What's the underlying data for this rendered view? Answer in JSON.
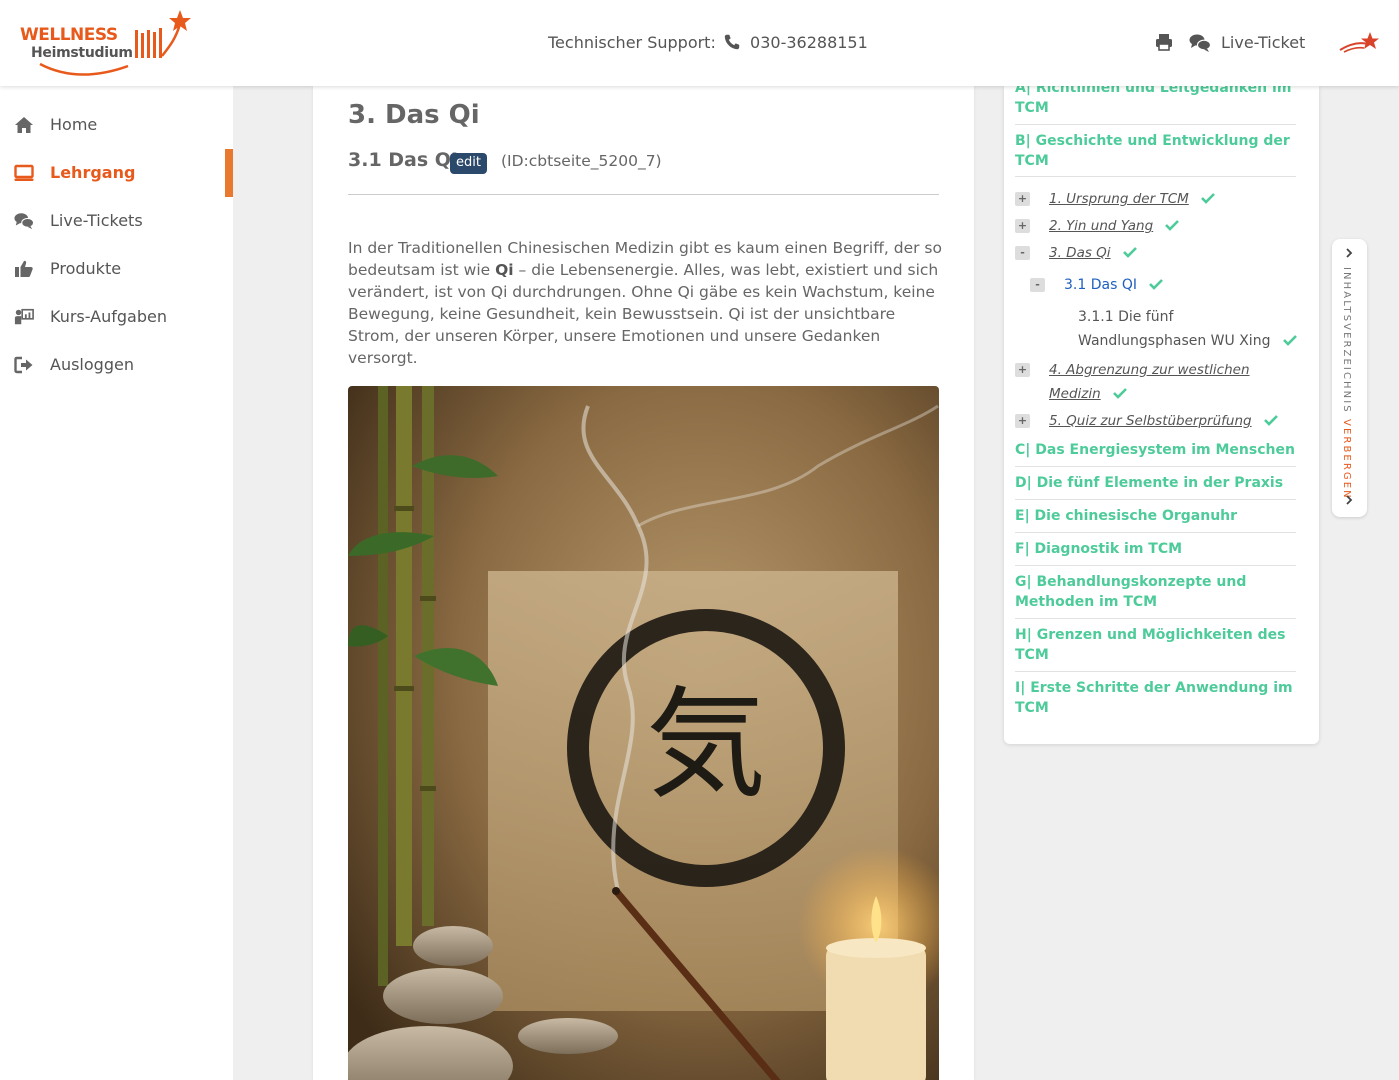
{
  "brand": {
    "logo_top": "WELLNESS",
    "logo_bottom": "Heimstudium",
    "accent": "#e8591c"
  },
  "header": {
    "support_label": "Technischer Support:",
    "support_phone": "030-36288151",
    "live_ticket_label": "Live-Ticket",
    "icons": [
      "phone-icon",
      "print-icon",
      "chat-icon",
      "star-logo-icon"
    ]
  },
  "sidebar": {
    "items": [
      {
        "label": "Home",
        "icon": "home-icon",
        "active": false
      },
      {
        "label": "Lehrgang",
        "icon": "monitor-icon",
        "active": true
      },
      {
        "label": "Live-Tickets",
        "icon": "chat-icon",
        "active": false
      },
      {
        "label": "Produkte",
        "icon": "thumbs-up-icon",
        "active": false
      },
      {
        "label": "Kurs-Aufgaben",
        "icon": "classroom-icon",
        "active": false
      },
      {
        "label": "Ausloggen",
        "icon": "logout-icon",
        "active": false
      }
    ]
  },
  "content": {
    "chapter_title": "3. Das Qi",
    "subtitle": "3.1 Das QI",
    "edit_badge": "edit",
    "page_id": "(ID:cbtseite_5200_7)",
    "para_part1": "In der Traditionellen Chinesischen Medizin gibt es kaum einen Begriff, der so bedeutsam ist wie ",
    "para_bold": "Qi",
    "para_part2": " – die Lebensenergie. Alles, was lebt, existiert und sich verändert, ist von Qi durchdrungen. Ohne Qi gäbe es kein Wachstum, keine Bewegung, keine Gesundheit, kein Bewusstsein. Qi ist der unsichtbare Strom, der unseren Körper, unsere Emotionen und unsere Gedanken versorgt.",
    "image_calligraphy": "気"
  },
  "toc": {
    "sections": [
      "A| Richtlinien und Leitgedanken im TCM",
      "B| Geschichte und Entwicklung der TCM",
      "C| Das Energiesystem im Menschen",
      "D| Die fünf Elemente in der Praxis",
      "E| Die chinesische Organuhr",
      "F| Diagnostik im TCM",
      "G| Behandlungskonzepte und Methoden im TCM",
      "H| Grenzen und Möglichkeiten des TCM",
      "I| Erste Schritte der Anwendung im TCM"
    ],
    "chapters": [
      {
        "toggle": "+",
        "label": "1. Ursprung der TCM"
      },
      {
        "toggle": "+",
        "label": "2. Yin und Yang"
      },
      {
        "toggle": "-",
        "label": "3. Das Qi"
      },
      {
        "toggle": "+",
        "label": "4. Abgrenzung zur westlichen Medizin"
      },
      {
        "toggle": "+",
        "label": "5. Quiz zur Selbstüberprüfung"
      }
    ],
    "current": {
      "toggle": "-",
      "label": "3.1 Das QI"
    },
    "subpage": "3.1.1 Die fünf Wandlungsphasen WU Xing",
    "check_color": "#4ecb9a",
    "tab_label": "INHALTSVERZEICHNIS",
    "tab_action": "VERBERGEN"
  }
}
